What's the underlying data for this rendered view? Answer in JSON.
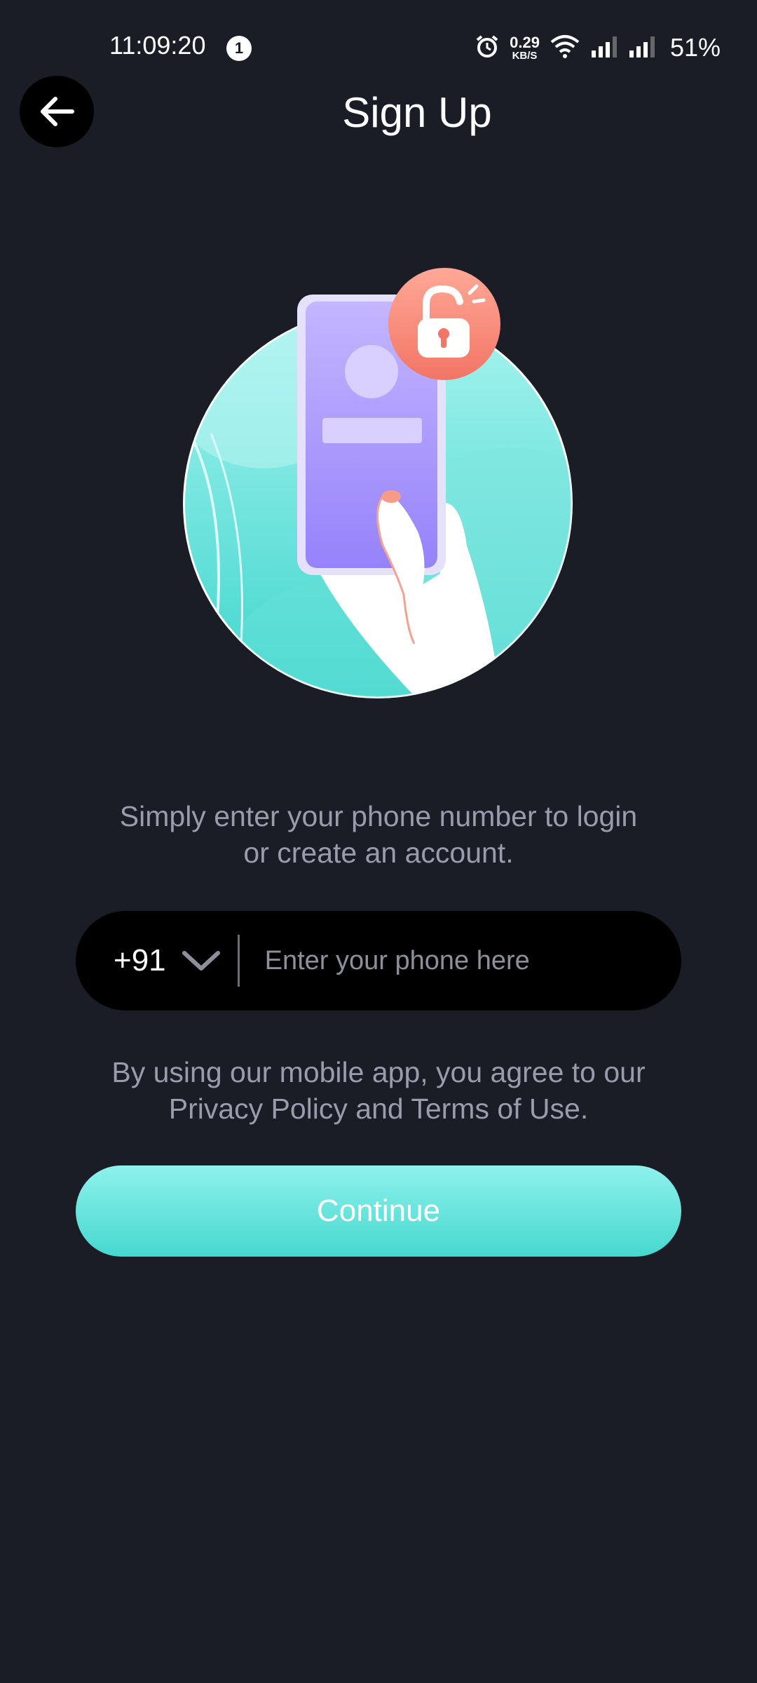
{
  "status_bar": {
    "time": "11:09:20",
    "notification_count": "1",
    "net_speed_value": "0.29",
    "net_speed_unit": "KB/S",
    "battery": "51%"
  },
  "header": {
    "title": "Sign Up"
  },
  "main": {
    "intro_line1": "Simply enter your phone number to login",
    "intro_line2": "or create an account.",
    "country_code": "+91",
    "phone_placeholder": "Enter your phone here",
    "terms_line1": "By using our mobile app, you agree to our",
    "terms_line2": "Privacy Policy and Terms of Use.",
    "continue_label": "Continue"
  },
  "colors": {
    "background": "#1a1c26",
    "accent": "#45d8cf",
    "muted_text": "#9a9cae"
  }
}
